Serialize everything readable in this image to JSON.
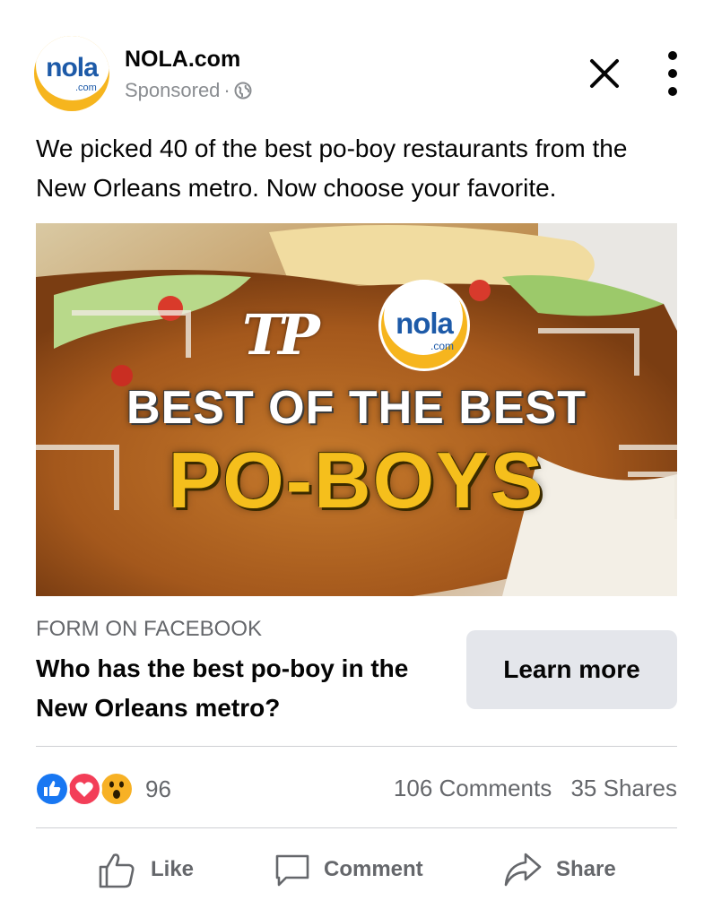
{
  "post": {
    "page_name": "NOLA.com",
    "sponsored_label": "Sponsored",
    "separator": "·",
    "text": "We picked 40 of the best po-boy restaurants from the New Orleans metro. Now choose your favorite."
  },
  "avatar": {
    "logo_text": "nola",
    "logo_sub": ".com"
  },
  "image": {
    "publisher_mark": "TP",
    "badge_text": "nola",
    "badge_sub": ".com",
    "headline_line1": "BEST OF THE BEST",
    "headline_line2": "PO-BOYS",
    "colors": {
      "headline_yellow": "#f5bf1c",
      "nola_blue": "#1d5aa8",
      "nola_yellow": "#f6b51e"
    }
  },
  "cta": {
    "source": "FORM ON FACEBOOK",
    "headline": "Who has the best po-boy in the New Orleans metro?",
    "button_label": "Learn more"
  },
  "engagement": {
    "reaction_icons": [
      "like-icon",
      "love-icon",
      "wow-icon"
    ],
    "reaction_count": "96",
    "comments": "106 Comments",
    "shares": "35 Shares"
  },
  "actions": {
    "like": "Like",
    "comment": "Comment",
    "share": "Share"
  },
  "colors": {
    "like_blue": "#1877f2",
    "love_red": "#f33e58",
    "wow_yellow": "#f7b125",
    "secondary_text": "#65676b"
  }
}
